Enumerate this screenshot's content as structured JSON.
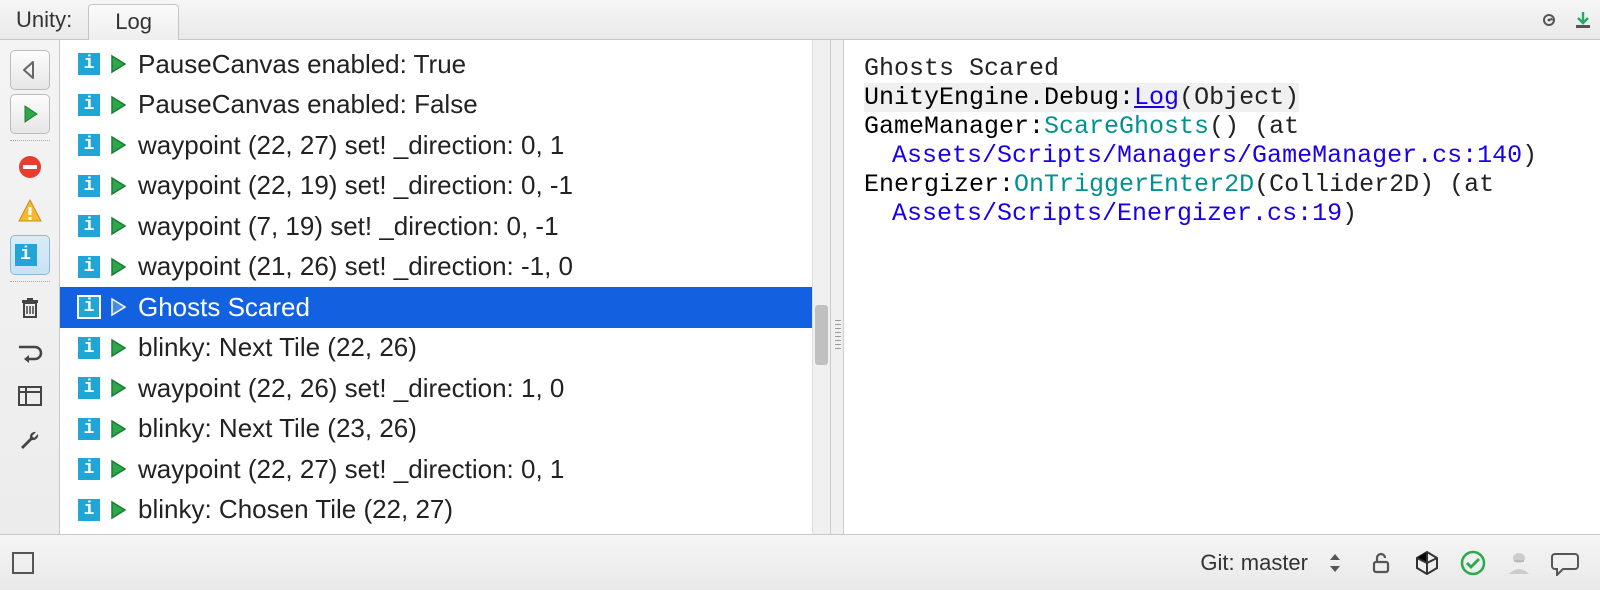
{
  "header": {
    "app_label": "Unity:",
    "tab_label": "Log"
  },
  "sidebar": {
    "buttons": [
      {
        "name": "back-icon"
      },
      {
        "name": "play-icon"
      },
      {
        "name": "error-filter-icon"
      },
      {
        "name": "warning-filter-icon"
      },
      {
        "name": "info-filter-icon"
      },
      {
        "name": "trash-icon"
      },
      {
        "name": "wrap-icon"
      },
      {
        "name": "columns-icon"
      },
      {
        "name": "settings-icon"
      }
    ]
  },
  "log": {
    "selected_index": 6,
    "entries": [
      "PauseCanvas enabled: True",
      "PauseCanvas enabled: False",
      "waypoint (22, 27) set! _direction: 0, 1",
      "waypoint (22, 19) set! _direction: 0, -1",
      "waypoint (7, 19) set! _direction: 0, -1",
      "waypoint (21, 26) set! _direction: -1, 0",
      "Ghosts Scared",
      "blinky: Next Tile (22, 26)",
      "waypoint (22, 26) set! _direction: 1, 0",
      "blinky: Next Tile (23, 26)",
      "waypoint (22, 27) set! _direction: 0, 1",
      "blinky: Chosen Tile (22, 27)"
    ]
  },
  "detail": {
    "message": "Ghosts Scared",
    "line2_class": "UnityEngine.Debug:",
    "line2_method": "Log",
    "line2_args": "(Object)",
    "frame1_class": "GameManager:",
    "frame1_method": "ScareGhosts",
    "frame1_tail": "() (at",
    "frame1_path": "Assets/Scripts/Managers/GameManager.cs:140",
    "frame1_close": ")",
    "frame2_class": "Energizer:",
    "frame2_method": "OnTriggerEnter2D",
    "frame2_tail": "(Collider2D) (at",
    "frame2_path": "Assets/Scripts/Energizer.cs:19",
    "frame2_close": ")"
  },
  "status": {
    "git_label": "Git: master"
  }
}
